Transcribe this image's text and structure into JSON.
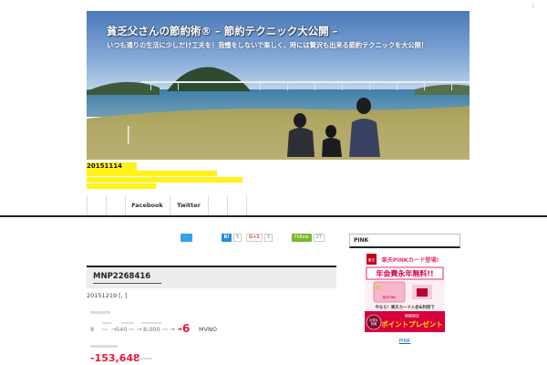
{
  "ad_marker": "i",
  "header": {
    "site_title": "貧乏父さんの節約術® – 節約テクニック大公開 –",
    "site_description": "いつも通りの生活に少しだけ工夫を！我慢をしないで楽しく、時には贅沢も出来る節約テクニックを大公開！"
  },
  "meta": {
    "date": "20151114"
  },
  "nav": {
    "items": [
      "Facebook",
      "Twitter"
    ]
  },
  "share": {
    "twitter_glyph": "🐦",
    "hatena_label": "B!",
    "hatena_count": "5",
    "gplus_label": "G+1",
    "gplus_count": "3",
    "follow_label": "Follow",
    "follow_count": "27"
  },
  "article": {
    "title": "MNP2268416",
    "meta_line": "20151219 [, ]",
    "stats": {
      "before": "8",
      "current": "540",
      "after": "8,000",
      "diff": "-6",
      "mvno": "MVNO",
      "saving": "-153,648"
    }
  },
  "sidebar": {
    "heading": "PINK",
    "ad": {
      "brand": "楽天",
      "headline": "楽天PINKカード登場!",
      "annual_fee": "年会費永年無料!!",
      "promo_line": "今なら！楽天カード入会&利用で",
      "limited": "期間限定",
      "badge_line1": "お得な",
      "badge_line2": "特典",
      "cta": "ポイントプレゼント",
      "card_label": "楽天PINK"
    },
    "link_text": "PINK"
  },
  "colors": {
    "accent_red": "#e8193c",
    "highlight_yellow": "#fff21a",
    "twitter_blue": "#2aa3ef",
    "feedly_green": "#79b82c",
    "link_blue": "#1a5fb4"
  }
}
